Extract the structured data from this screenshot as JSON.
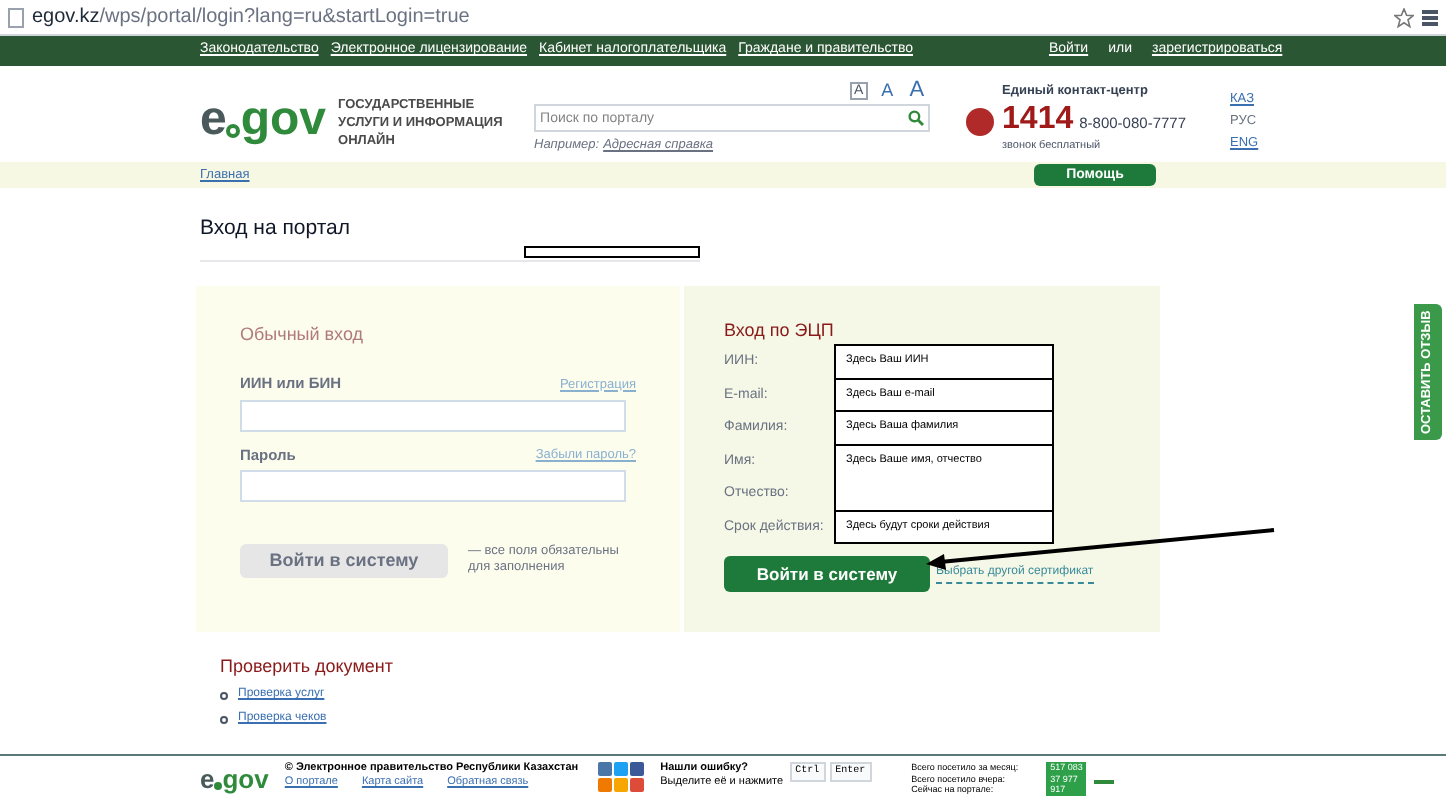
{
  "browser": {
    "url_host": "egov.kz",
    "url_path": "/wps/portal/login?lang=ru&startLogin=true"
  },
  "top_nav": {
    "links": [
      "Законодательство",
      "Электронное лицензирование",
      "Кабинет налогоплательщика",
      "Граждане и правительство"
    ],
    "login": "Войти",
    "or": "или",
    "register": "зарегистрироваться"
  },
  "header": {
    "logo": [
      "e",
      "gov"
    ],
    "tagline": "ГОСУДАРСТВЕННЫЕ УСЛУГИ И ИНФОРМАЦИЯ ОНЛАЙН",
    "font_sizes": [
      {
        "label": "A",
        "selected": true
      },
      {
        "label": "A",
        "selected": false
      },
      {
        "label": "A",
        "selected": false
      }
    ],
    "search": {
      "placeholder": "Поиск по порталу"
    },
    "example_label": "Например:",
    "example_link": "Адресная справка",
    "contact_title": "Единый контакт-центр",
    "short_number": "1414",
    "phone": "8-800-080-7777",
    "free_call": "звонок бесплатный",
    "languages": [
      {
        "label": "КАЗ",
        "selected": false
      },
      {
        "label": "РУС",
        "selected": true
      },
      {
        "label": "ENG",
        "selected": false
      }
    ]
  },
  "breadcrumb": "Главная",
  "help": "Помощь",
  "page_title": "Вход на портал",
  "standard_login": {
    "title": "Обычный вход",
    "fields": [
      {
        "label": "ИИН или БИН",
        "link": "Регистрация"
      },
      {
        "label": "Пароль",
        "link": "Забыли пароль?"
      }
    ],
    "button": {
      "label": "Войти в систему",
      "disabled": true
    },
    "note": "— все поля обязательны для заполнения"
  },
  "ecp_login": {
    "title": "Вход по ЭЦП",
    "rows": [
      {
        "label": "ИИН:",
        "value": "Здесь Ваш ИИН"
      },
      {
        "label": "E-mail:",
        "value": "Здесь Ваш e-mail"
      },
      {
        "label": "Фамилия:",
        "value": "Здесь Ваша фамилия"
      },
      {
        "label": "Имя:",
        "value": "Здесь Ваше имя, отчество"
      },
      {
        "label": "Отчество:"
      },
      {
        "label": "Срок действия:",
        "value": "Здесь будут сроки действия"
      }
    ],
    "button": "Войти в систему",
    "link": "Выбрать другой сертификат"
  },
  "check_document": {
    "title": "Проверить документ",
    "links": [
      "Проверка услуг",
      "Проверка чеков"
    ]
  },
  "feedback_tab": "ОСТАВИТЬ ОТЗЫВ",
  "footer": {
    "logo": [
      "e",
      "gov"
    ],
    "copyright": "© Электронное правительство Республики Казахстан",
    "links": [
      "О портале",
      "Карта сайта",
      "Обратная связь"
    ],
    "error_title": "Нашли ошибку?",
    "error_text": "Выделите её и нажмите",
    "keys": [
      "Ctrl",
      "Enter"
    ],
    "stats": [
      "Всего посетило за месяц:",
      "Всего посетило вчера:",
      "Сейчас на портале:"
    ],
    "counter": [
      "517 083",
      "37 977",
      "917"
    ]
  }
}
